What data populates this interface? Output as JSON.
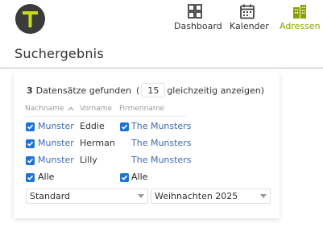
{
  "app": {
    "logo_letter": "T"
  },
  "nav": {
    "dashboard": "Dashboard",
    "kalender": "Kalender",
    "adressen": "Adressen"
  },
  "page": {
    "title": "Suchergebnis"
  },
  "results": {
    "count": "3",
    "count_text": "Datensätze gefunden",
    "paren_open": "(",
    "per_page": "15",
    "per_page_suffix": "gleichzeitig anzeigen)"
  },
  "columns": {
    "nachname": "Nachname",
    "vorname": "Vorname",
    "firmenname": "Firmenname"
  },
  "rows": [
    {
      "nachname": "Munster",
      "vorname": "Eddie",
      "firma": "The Munsters",
      "nachname_checked": true,
      "firma_checked": true
    },
    {
      "nachname": "Munster",
      "vorname": "Herman",
      "firma": "The Munsters",
      "nachname_checked": true,
      "firma_checked": false
    },
    {
      "nachname": "Munster",
      "vorname": "Lilly",
      "firma": "The Munsters",
      "nachname_checked": true,
      "firma_checked": false
    }
  ],
  "all_row": {
    "left": "Alle",
    "right": "Alle"
  },
  "selects": {
    "template": "Standard",
    "event": "Weihnachten 2025"
  },
  "colors": {
    "accent": "#8aa000",
    "link": "#3d6bb3",
    "checkbox": "#1e73d6",
    "logo_bg": "#3b3b3b",
    "logo_letter": "#c8dc1e"
  },
  "icons": {
    "dashboard": "grid-icon",
    "kalender": "calendar-icon",
    "adressen": "buildings-icon",
    "sort": "sort-asc-icon",
    "caret": "chevron-down-icon",
    "check": "check-icon"
  }
}
